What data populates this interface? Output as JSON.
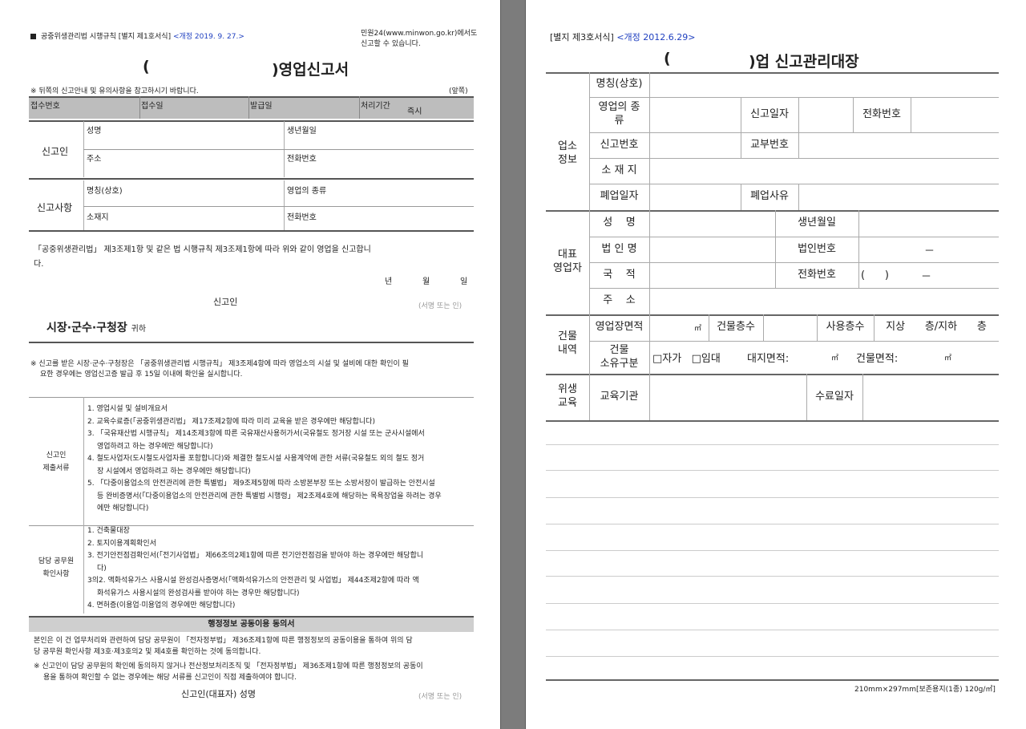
{
  "form1": {
    "regulation": "공중위생관리법 시행규칙 [별지 제1호서식]",
    "revision": "<개정 2019. 9. 27.>",
    "minwon_line1": "민원24(www.minwon.go.kr)에서도",
    "minwon_line2": "신고할 수 있습니다.",
    "title_open": "(",
    "title_close": ")영업신고서",
    "notice": "※ 뒤쪽의 신고안내 및 유의사항을 참고하시기 바랍니다.",
    "front_mark": "(앞쪽)",
    "head_cols": [
      "접수번호",
      "접수일",
      "발급일",
      "처리기간"
    ],
    "processing_period": "즉시",
    "applicant_label": "신고인",
    "applicant_fields": [
      "성명",
      "생년월일",
      "주소",
      "전화번호"
    ],
    "report_label": "신고사항",
    "report_fields": [
      "명칭(상호)",
      "영업의 종류",
      "소재지",
      "전화번호"
    ],
    "declaration_line1": "「공중위생관리법」 제3조제1항 및 같은 법 시행규칙 제3조제1항에 따라 위와 같이 영업을 신고합니",
    "declaration_line2": "다.",
    "date_year": "년",
    "date_month": "월",
    "date_day": "일",
    "signer": "신고인",
    "sign_note": "(서명 또는 인)",
    "addressee": "시장·군수·구청장",
    "addressee_suffix": "귀하",
    "inspection_line1": "※ 신고를 받은 시장·군수·구청장은 「공중위생관리법 시행규칙」 제3조제4항에 따라 영업소의 시설 및 설비에 대한 확인이 필",
    "inspection_line2": "요한 경우에는 영업신고증 발급 후 15일 이내에 확인을 실시합니다.",
    "submit_label_1": "신고인",
    "submit_label_2": "제출서류",
    "submit_items": [
      "1. 영업시설 및 설비개요서",
      "2. 교육수료증(「공중위생관리법」 제17조제2항에 따라 미리 교육을 받은 경우에만 해당합니다)",
      "3. 「국유재산법 시행규칙」 제14조제3항에 따른 국유재산사용허가서(국유철도 정거장 시설 또는 군사시설에서",
      "   영업하려고 하는 경우에만 해당합니다)",
      "4. 철도사업자(도시철도사업자를 포함합니다)와 체결한 철도시설 사용계약에 관한 서류(국유철도 외의 철도 정거",
      "   장 시설에서 영업하려고 하는 경우에만 해당합니다)",
      "5. 「다중이용업소의 안전관리에 관한 특별법」 제9조제5항에 따라 소방본부장 또는 소방서장이 발급하는 안전시설",
      "   등 완비증명서(「다중이용업소의 안전관리에 관한 특별법 시행령」 제2조제4호에 해당하는 목욕장업을 하려는 경우",
      "   에만 해당합니다)"
    ],
    "official_label_1": "담당 공무원",
    "official_label_2": "확인사항",
    "official_items": [
      "1. 건축물대장",
      "2. 토지이용계획확인서",
      "3. 전기안전점검확인서(「전기사업법」 제66조의2제1항에 따른 전기안전점검을 받아야 하는 경우에만 해당합니",
      "   다)",
      "3의2. 액화석유가스 사용시설 완성검사증명서(「액화석유가스의 안전관리 및 사업법」 제44조제2항에 따라 액",
      "   화석유가스 사용시설의 완성검사를 받아야 하는 경우만 해당합니다)",
      "4. 면허증(이용업·미용업의 경우에만 해당합니다)"
    ],
    "consent_title": "행정정보 공동이용 동의서",
    "consent_line1": "본인은 이 건 업무처리와 관련하여 담당 공무원이 「전자정부법」 제36조제1항에 따른 행정정보의 공동이용을 통하여 위의 담",
    "consent_line2": "당 공무원 확인사항 제3호·제3호의2 및 제4호를 확인하는 것에 동의합니다.",
    "consent_note1": "※ 신고인이 담당 공무원의 확인에 동의하지 않거나 전산정보처리조직 및 「전자정부법」 제36조제1항에 따른 행정정보의 공동이",
    "consent_note2": "용을 통하여 확인할 수 없는 경우에는 해당 서류를 신고인이 직접 제출하여야 합니다.",
    "final_signer": "신고인(대표자) 성명",
    "final_sign_note": "(서명 또는 인)"
  },
  "form2": {
    "form_no": "[별지 제3호서식]",
    "revision": "<개정 2012.6.29>",
    "title_open": "(",
    "title_close": ")업 신고관리대장",
    "sec_business": "업소\n정보",
    "biz_name": "명칭(상호)",
    "biz_type": "영업의 종\n류",
    "report_date": "신고일자",
    "phone": "전화번호",
    "report_no": "신고번호",
    "issue_no": "교부번호",
    "location": "소 재 지",
    "closure_date": "폐업일자",
    "closure_reason": "폐업사유",
    "sec_rep": "대표\n영업자",
    "rep_name": "성    명",
    "birth": "생년월일",
    "corp_name": "법 인 명",
    "corp_no": "법인번호",
    "corp_no_dash": "－",
    "nationality": "국    적",
    "rep_phone": "전화번호",
    "phone_paren": "(      )",
    "phone_dash": "－",
    "address": "주    소",
    "sec_bldg": "건물\n내역",
    "area": "영업장면적",
    "area_unit": "㎡",
    "floors": "건물층수",
    "use_floor": "사용층수",
    "floor_text": "지상      층/지하      층",
    "ownership": "건물\n소유구분",
    "own_options": "□자가   □임대",
    "land_area": "대지면적:",
    "land_unit": "㎡",
    "bldg_area": "건물면적:",
    "bldg_unit": "㎡",
    "sec_edu": "위생\n교육",
    "edu_org": "교육기관",
    "edu_date": "수료일자",
    "paper_spec": "210mm×297mm[보존용지(1종) 120g/㎡]"
  }
}
